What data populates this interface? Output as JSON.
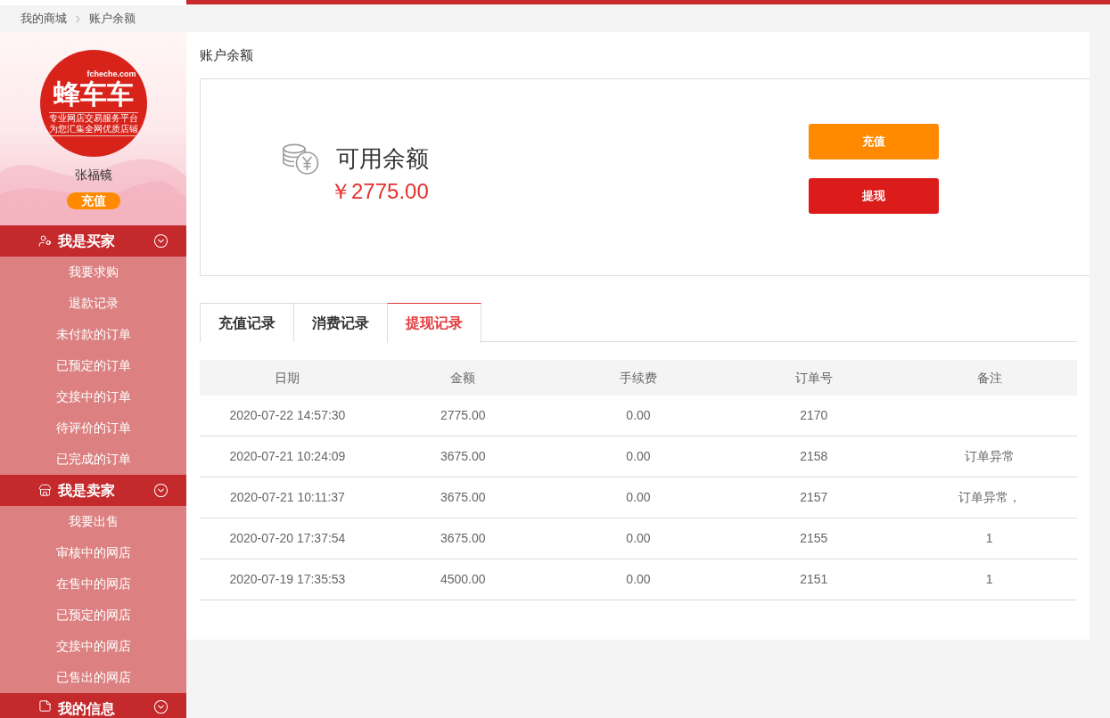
{
  "breadcrumb": [
    "我的商城",
    "账户余额"
  ],
  "sidebar": {
    "logo": {
      "domain": "fcheche.com",
      "brand": "蜂车车",
      "taglines": [
        "专业网店交易服务平台",
        "为您汇集全网优质店铺"
      ]
    },
    "username": "张福镜",
    "recharge_button": "充值",
    "sections": [
      {
        "title": "我是买家",
        "kind": "buyer",
        "items": [
          "我要求购",
          "退款记录",
          "未付款的订单",
          "已预定的订单",
          "交接中的订单",
          "待评价的订单",
          "已完成的订单"
        ]
      },
      {
        "title": "我是卖家",
        "kind": "seller",
        "items": [
          "我要出售",
          "审核中的网店",
          "在售中的网店",
          "已预定的网店",
          "交接中的网店",
          "已售出的网店"
        ]
      },
      {
        "title": "我的信息",
        "kind": "info"
      }
    ]
  },
  "page_title": "账户余额",
  "balance": {
    "label": "可用余额",
    "amount": "￥2775.00",
    "buttons": [
      {
        "label": "充值",
        "kind": "recharge"
      },
      {
        "label": "提现",
        "kind": "withdraw"
      }
    ]
  },
  "tabs": [
    {
      "label": "充值记录",
      "selected": false
    },
    {
      "label": "消费记录",
      "selected": false
    },
    {
      "label": "提现记录",
      "selected": true
    }
  ],
  "table": {
    "columns": [
      "日期",
      "金额",
      "手续费",
      "订单号",
      "备注"
    ],
    "rows": [
      {
        "date": "2020-07-22 14:57:30",
        "amount": "2775.00",
        "fee": "0.00",
        "order_no": "2170"
      },
      {
        "date": "2020-07-21 10:24:09",
        "amount": "3675.00",
        "fee": "0.00",
        "order_no": "2158",
        "remark": "订单异常"
      },
      {
        "date": "2020-07-21 10:11:37",
        "amount": "3675.00",
        "fee": "0.00",
        "order_no": "2157",
        "remark": "订单异常，"
      },
      {
        "date": "2020-07-20 17:37:54",
        "amount": "3675.00",
        "fee": "0.00",
        "order_no": "2155",
        "remark": "1"
      },
      {
        "date": "2020-07-19 17:35:53",
        "amount": "4500.00",
        "fee": "0.00",
        "order_no": "2151",
        "remark": "1"
      }
    ]
  }
}
